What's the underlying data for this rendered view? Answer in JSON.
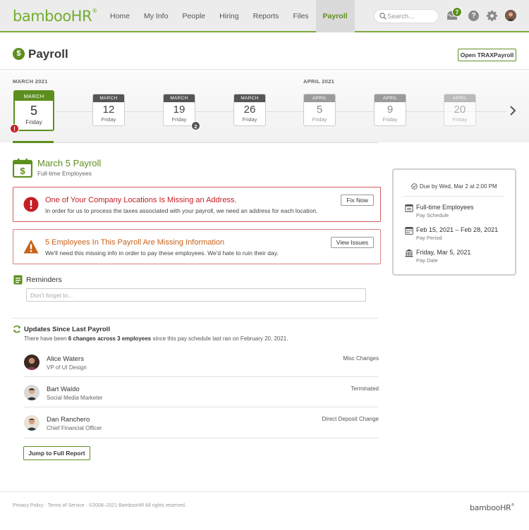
{
  "header": {
    "logo_text": "bambooHR",
    "logo_reg": "®",
    "nav": [
      {
        "label": "Home"
      },
      {
        "label": "My Info"
      },
      {
        "label": "People"
      },
      {
        "label": "Hiring"
      },
      {
        "label": "Reports"
      },
      {
        "label": "Files"
      },
      {
        "label": "Payroll",
        "active": true
      }
    ],
    "search_placeholder": "Search...",
    "inbox_count": "7",
    "help_label": "?"
  },
  "page": {
    "title": "Payroll",
    "title_icon": "$",
    "open_trax_label": "Open TRAXPayroll"
  },
  "calendar": {
    "month_labels": [
      "MARCH 2021",
      "APRIL 2021"
    ],
    "days": [
      {
        "month": "MARCH",
        "day": "5",
        "weekday": "Friday",
        "state": "selected",
        "alert": "!"
      },
      {
        "month": "MARCH",
        "day": "12",
        "weekday": "Friday",
        "state": "past"
      },
      {
        "month": "MARCH",
        "day": "19",
        "weekday": "Friday",
        "state": "past",
        "count": "2"
      },
      {
        "month": "MARCH",
        "day": "26",
        "weekday": "Friday",
        "state": "past"
      },
      {
        "month": "APRIL",
        "day": "5",
        "weekday": "Friday",
        "state": "future"
      },
      {
        "month": "APRIL",
        "day": "9",
        "weekday": "Friday",
        "state": "future"
      },
      {
        "month": "APRIL",
        "day": "20",
        "weekday": "Friday",
        "state": "future"
      }
    ]
  },
  "payroll": {
    "title": "March 5 Payroll",
    "subtitle": "Full-time Employees"
  },
  "alerts": [
    {
      "title": "One of Your Company Locations Is Missing an Address.",
      "text": "In order for us to process the taxes associated with your payroll, we need an address for each location.",
      "button": "Fix Now",
      "severity": "error"
    },
    {
      "title": "5 Employees In This Payroll Are Missing Information",
      "text": "We'll need this missing info in order to pay these employees. We'd hate to ruin their day.",
      "button": "View Issues",
      "severity": "warning"
    }
  ],
  "reminders": {
    "title": "Reminders",
    "placeholder": "Don't forget to..."
  },
  "updates": {
    "title": "Updates Since Last Payroll",
    "text_pre": "There have been ",
    "text_bold": "6 changes across 3 employees",
    "text_post": " since this pay schedule last ran on February 20, 2021.",
    "people": [
      {
        "name": "Alice Waters",
        "role": "VP of UI Design",
        "change": "Misc Changes"
      },
      {
        "name": "Bart Waldo",
        "role": "Social Media Marketer",
        "change": "Terminated"
      },
      {
        "name": "Dan Ranchero",
        "role": "Chief Financial Officer",
        "change": "Direct Deposit Change"
      }
    ],
    "report_button": "Jump to Full Report"
  },
  "side_panel": {
    "due": "Due by Wed, Mar 2 at 2:00 PM",
    "items": [
      {
        "main": "Full-time Employees",
        "sub": "Pay Schedule",
        "icon": "schedule-icon"
      },
      {
        "main": "Feb 15, 2021 – Feb 28, 2021",
        "sub": "Pay Period",
        "icon": "calendar-icon"
      },
      {
        "main": "Friday, Mar 5, 2021",
        "sub": "Pay Date",
        "icon": "bank-icon"
      }
    ]
  },
  "footer": {
    "text": "Privacy Policy · Terms of Service · ©2008–2021 BambooHR All rights reserved.",
    "logo_text": "bambooHR",
    "logo_reg": "®"
  },
  "colors": {
    "brand_green": "#5d8f1e",
    "error_red": "#c41e24",
    "warning_orange": "#c8621a"
  }
}
